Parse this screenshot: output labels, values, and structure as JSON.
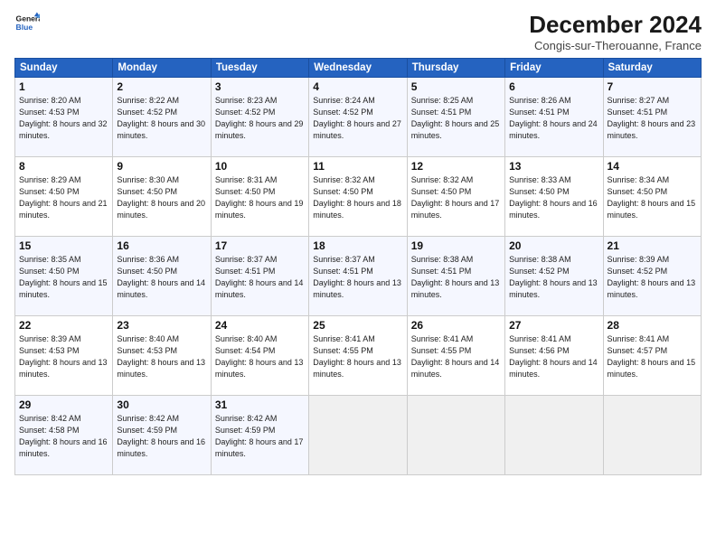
{
  "logo": {
    "line1": "General",
    "line2": "Blue"
  },
  "title": "December 2024",
  "subtitle": "Congis-sur-Therouanne, France",
  "weekdays": [
    "Sunday",
    "Monday",
    "Tuesday",
    "Wednesday",
    "Thursday",
    "Friday",
    "Saturday"
  ],
  "weeks": [
    [
      {
        "day": "1",
        "sunrise": "Sunrise: 8:20 AM",
        "sunset": "Sunset: 4:53 PM",
        "daylight": "Daylight: 8 hours and 32 minutes."
      },
      {
        "day": "2",
        "sunrise": "Sunrise: 8:22 AM",
        "sunset": "Sunset: 4:52 PM",
        "daylight": "Daylight: 8 hours and 30 minutes."
      },
      {
        "day": "3",
        "sunrise": "Sunrise: 8:23 AM",
        "sunset": "Sunset: 4:52 PM",
        "daylight": "Daylight: 8 hours and 29 minutes."
      },
      {
        "day": "4",
        "sunrise": "Sunrise: 8:24 AM",
        "sunset": "Sunset: 4:52 PM",
        "daylight": "Daylight: 8 hours and 27 minutes."
      },
      {
        "day": "5",
        "sunrise": "Sunrise: 8:25 AM",
        "sunset": "Sunset: 4:51 PM",
        "daylight": "Daylight: 8 hours and 25 minutes."
      },
      {
        "day": "6",
        "sunrise": "Sunrise: 8:26 AM",
        "sunset": "Sunset: 4:51 PM",
        "daylight": "Daylight: 8 hours and 24 minutes."
      },
      {
        "day": "7",
        "sunrise": "Sunrise: 8:27 AM",
        "sunset": "Sunset: 4:51 PM",
        "daylight": "Daylight: 8 hours and 23 minutes."
      }
    ],
    [
      {
        "day": "8",
        "sunrise": "Sunrise: 8:29 AM",
        "sunset": "Sunset: 4:50 PM",
        "daylight": "Daylight: 8 hours and 21 minutes."
      },
      {
        "day": "9",
        "sunrise": "Sunrise: 8:30 AM",
        "sunset": "Sunset: 4:50 PM",
        "daylight": "Daylight: 8 hours and 20 minutes."
      },
      {
        "day": "10",
        "sunrise": "Sunrise: 8:31 AM",
        "sunset": "Sunset: 4:50 PM",
        "daylight": "Daylight: 8 hours and 19 minutes."
      },
      {
        "day": "11",
        "sunrise": "Sunrise: 8:32 AM",
        "sunset": "Sunset: 4:50 PM",
        "daylight": "Daylight: 8 hours and 18 minutes."
      },
      {
        "day": "12",
        "sunrise": "Sunrise: 8:32 AM",
        "sunset": "Sunset: 4:50 PM",
        "daylight": "Daylight: 8 hours and 17 minutes."
      },
      {
        "day": "13",
        "sunrise": "Sunrise: 8:33 AM",
        "sunset": "Sunset: 4:50 PM",
        "daylight": "Daylight: 8 hours and 16 minutes."
      },
      {
        "day": "14",
        "sunrise": "Sunrise: 8:34 AM",
        "sunset": "Sunset: 4:50 PM",
        "daylight": "Daylight: 8 hours and 15 minutes."
      }
    ],
    [
      {
        "day": "15",
        "sunrise": "Sunrise: 8:35 AM",
        "sunset": "Sunset: 4:50 PM",
        "daylight": "Daylight: 8 hours and 15 minutes."
      },
      {
        "day": "16",
        "sunrise": "Sunrise: 8:36 AM",
        "sunset": "Sunset: 4:50 PM",
        "daylight": "Daylight: 8 hours and 14 minutes."
      },
      {
        "day": "17",
        "sunrise": "Sunrise: 8:37 AM",
        "sunset": "Sunset: 4:51 PM",
        "daylight": "Daylight: 8 hours and 14 minutes."
      },
      {
        "day": "18",
        "sunrise": "Sunrise: 8:37 AM",
        "sunset": "Sunset: 4:51 PM",
        "daylight": "Daylight: 8 hours and 13 minutes."
      },
      {
        "day": "19",
        "sunrise": "Sunrise: 8:38 AM",
        "sunset": "Sunset: 4:51 PM",
        "daylight": "Daylight: 8 hours and 13 minutes."
      },
      {
        "day": "20",
        "sunrise": "Sunrise: 8:38 AM",
        "sunset": "Sunset: 4:52 PM",
        "daylight": "Daylight: 8 hours and 13 minutes."
      },
      {
        "day": "21",
        "sunrise": "Sunrise: 8:39 AM",
        "sunset": "Sunset: 4:52 PM",
        "daylight": "Daylight: 8 hours and 13 minutes."
      }
    ],
    [
      {
        "day": "22",
        "sunrise": "Sunrise: 8:39 AM",
        "sunset": "Sunset: 4:53 PM",
        "daylight": "Daylight: 8 hours and 13 minutes."
      },
      {
        "day": "23",
        "sunrise": "Sunrise: 8:40 AM",
        "sunset": "Sunset: 4:53 PM",
        "daylight": "Daylight: 8 hours and 13 minutes."
      },
      {
        "day": "24",
        "sunrise": "Sunrise: 8:40 AM",
        "sunset": "Sunset: 4:54 PM",
        "daylight": "Daylight: 8 hours and 13 minutes."
      },
      {
        "day": "25",
        "sunrise": "Sunrise: 8:41 AM",
        "sunset": "Sunset: 4:55 PM",
        "daylight": "Daylight: 8 hours and 13 minutes."
      },
      {
        "day": "26",
        "sunrise": "Sunrise: 8:41 AM",
        "sunset": "Sunset: 4:55 PM",
        "daylight": "Daylight: 8 hours and 14 minutes."
      },
      {
        "day": "27",
        "sunrise": "Sunrise: 8:41 AM",
        "sunset": "Sunset: 4:56 PM",
        "daylight": "Daylight: 8 hours and 14 minutes."
      },
      {
        "day": "28",
        "sunrise": "Sunrise: 8:41 AM",
        "sunset": "Sunset: 4:57 PM",
        "daylight": "Daylight: 8 hours and 15 minutes."
      }
    ],
    [
      {
        "day": "29",
        "sunrise": "Sunrise: 8:42 AM",
        "sunset": "Sunset: 4:58 PM",
        "daylight": "Daylight: 8 hours and 16 minutes."
      },
      {
        "day": "30",
        "sunrise": "Sunrise: 8:42 AM",
        "sunset": "Sunset: 4:59 PM",
        "daylight": "Daylight: 8 hours and 16 minutes."
      },
      {
        "day": "31",
        "sunrise": "Sunrise: 8:42 AM",
        "sunset": "Sunset: 4:59 PM",
        "daylight": "Daylight: 8 hours and 17 minutes."
      },
      null,
      null,
      null,
      null
    ]
  ]
}
